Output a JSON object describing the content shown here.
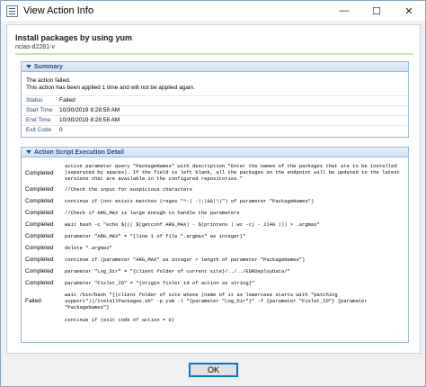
{
  "window": {
    "title": "View Action Info",
    "controls": {
      "minimize": "—",
      "maximize": "☐",
      "close": "✕"
    }
  },
  "header": {
    "title": "Install packages by using yum",
    "subtitle": "ncias-d2281-v"
  },
  "summary": {
    "label": "Summary",
    "message_line1": "The action failed.",
    "message_line2": "This action has been applied 1 time and will not be applied again.",
    "fields": [
      {
        "key": "Status",
        "value": "Failed"
      },
      {
        "key": "Start Time",
        "value": "10/30/2019 8:28:58 AM"
      },
      {
        "key": "End Time",
        "value": "10/30/2019 8:28:58 AM"
      },
      {
        "key": "Exit Code",
        "value": "0"
      }
    ]
  },
  "detail": {
    "label": "Action Script Execution Detail",
    "rows": [
      {
        "status": "Completed",
        "code": "action parameter query \"PackageNames\" with description \"Enter the names of the packages that are to be installed (separated by spaces). If the field is left blank, all the packages on the endpoint will be updated to the latest versions that are available in the configured repositories.\""
      },
      {
        "status": "Completed",
        "code": "//Check the input for suspicious characters"
      },
      {
        "status": "Completed",
        "code": "continue if (not exists matches (regex \"^-| -|;|&&|\\|\") of parameter \"PackageNames\")"
      },
      {
        "status": "Completed",
        "code": "//Check if ARG_MAX is large enough to handle the parameters"
      },
      {
        "status": "Completed",
        "code": "wait bash -c \"echo $((( $(getconf ARG_MAX) - $(printenv | wc -c) - 2148 ))) > .argmax\""
      },
      {
        "status": "Completed",
        "code": "parameter \"ARG_MAX\" = \"{line 1 of file \".argmax\" as integer}\""
      },
      {
        "status": "Completed",
        "code": "delete \".argmax\""
      },
      {
        "status": "Completed",
        "code": "continue if (parameter \"ARG_MAX\" as integer > length of parameter \"PackageNames\")"
      },
      {
        "status": "Completed",
        "code": "parameter \"Log_Dir\" = \"{client folder of current site}/../../EDRDeployData/\""
      },
      {
        "status": "Completed",
        "code": "parameter \"Fixlet_ID\" = \"{origin fixlet id of action as string}\""
      },
      {
        "status": "Failed",
        "code": "wait /bin/bash \"{(client folder of site whose (name of it as lowercase starts with \"patching support\"))/InstallPackages.sh\" -p yum -l \"{parameter \"Log_Dir\"}\" -f {parameter \"Fixlet_ID\"} {parameter \"PackageNames\"}"
      },
      {
        "status": "",
        "code": "continue if (exit code of action = 0)"
      }
    ]
  },
  "footer": {
    "ok_label": "OK"
  },
  "colors": {
    "accent": "#0078d7",
    "section_header": "#1f4f8f",
    "rule": "#c8e6a8"
  }
}
